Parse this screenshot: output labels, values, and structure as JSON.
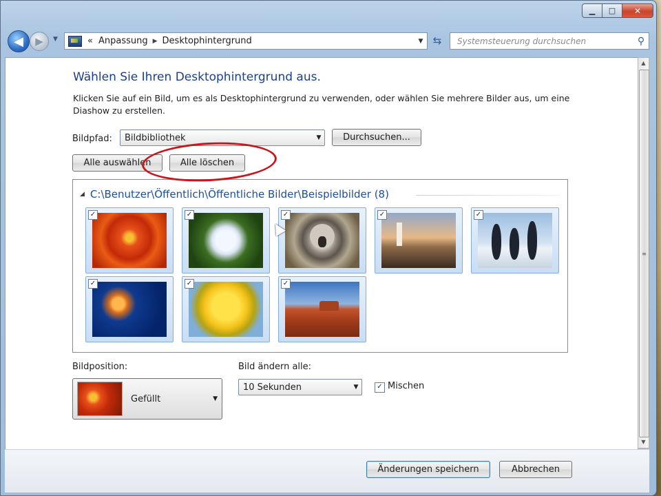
{
  "window": {
    "controls": {
      "minimize": "▁",
      "maximize": "□",
      "close": "✕"
    }
  },
  "toolbar": {
    "back_icon": "◀",
    "forward_icon": "▶",
    "breadcrumb_prefix": "«",
    "breadcrumb": [
      "Anpassung",
      "Desktophintergrund"
    ],
    "search_placeholder": "Systemsteuerung durchsuchen"
  },
  "main": {
    "heading": "Wählen Sie Ihren Desktophintergrund aus.",
    "description": "Klicken Sie auf ein Bild, um es als Desktophintergrund zu verwenden, oder wählen Sie mehrere Bilder aus, um eine Diashow zu erstellen.",
    "path_label": "Bildpfad:",
    "path_value": "Bildbibliothek",
    "browse_button": "Durchsuchen...",
    "select_all_button": "Alle auswählen",
    "clear_all_button": "Alle löschen",
    "group_header": "C:\\Benutzer\\Öffentlich\\Öffentliche Bilder\\Beispielbilder (8)",
    "images": [
      {
        "name": "chrysanthemum",
        "checked": true
      },
      {
        "name": "hydrangeas",
        "checked": true
      },
      {
        "name": "koala",
        "checked": true
      },
      {
        "name": "lighthouse",
        "checked": true
      },
      {
        "name": "penguins",
        "checked": true
      },
      {
        "name": "jellyfish",
        "checked": true
      },
      {
        "name": "tulips",
        "checked": true
      },
      {
        "name": "desert",
        "checked": true
      }
    ],
    "position_label": "Bildposition:",
    "position_value": "Gefüllt",
    "interval_label": "Bild ändern alle:",
    "interval_value": "10 Sekunden",
    "shuffle_label": "Mischen",
    "shuffle_checked": true
  },
  "footer": {
    "save_button": "Änderungen speichern",
    "cancel_button": "Abbrechen"
  },
  "colors": {
    "heading": "#1a3f8e",
    "group_header": "#1a4f9e",
    "annotation": "#c8161d"
  }
}
